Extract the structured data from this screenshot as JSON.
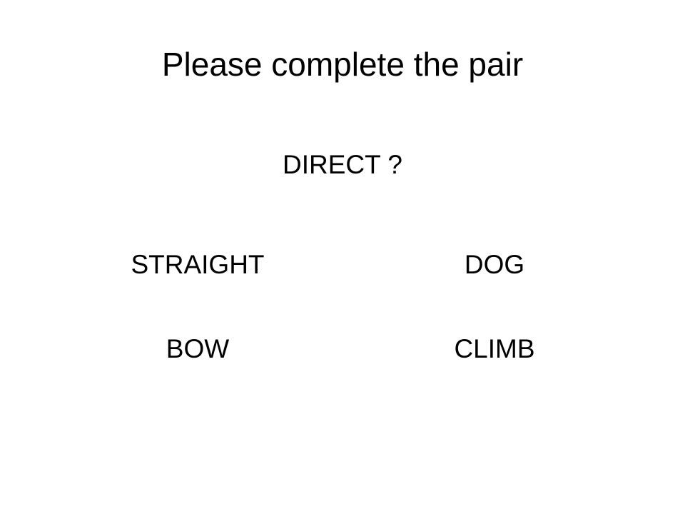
{
  "title": "Please complete the pair",
  "prompt": "DIRECT ?",
  "options": [
    "STRAIGHT",
    "DOG",
    "BOW",
    "CLIMB"
  ]
}
